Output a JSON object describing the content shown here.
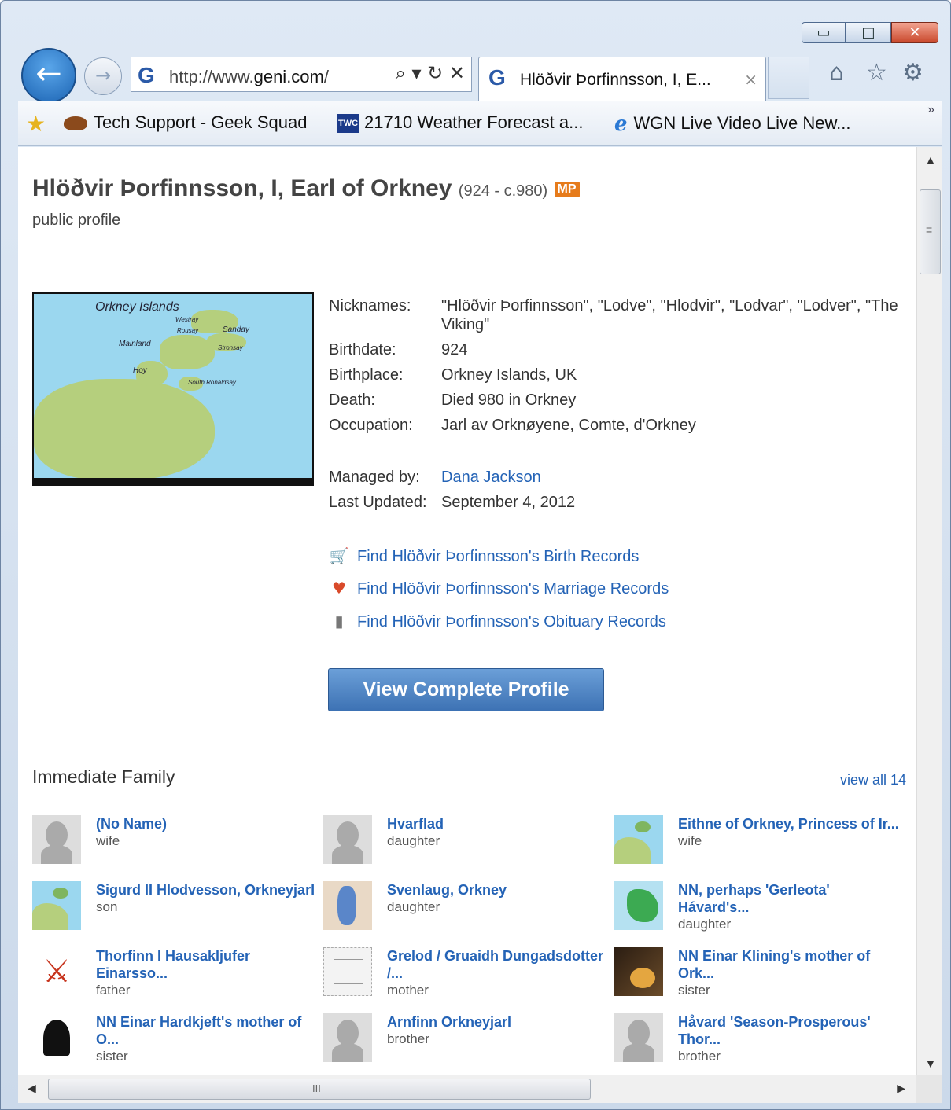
{
  "browser": {
    "window_controls": {
      "minimize": "▭",
      "maximize": "□",
      "close": "✕"
    },
    "address": {
      "prefix": "http://www.",
      "domain": "geni.com",
      "suffix": "/",
      "tools": "⌕ ▾ ↻ ✕"
    },
    "tab": {
      "title": "Hlöðvir Þorfinnsson, I, E...",
      "close": "×"
    },
    "icons": {
      "home": "⌂",
      "favorites": "☆",
      "settings": "⚙"
    },
    "favorites": [
      {
        "label": "Tech Support - Geek Squad",
        "icon": "geek-squad-icon"
      },
      {
        "label": "21710 Weather Forecast a...",
        "icon": "twc-icon",
        "badge": "TWC"
      },
      {
        "label": "WGN Live Video Live New...",
        "icon": "ie-page-icon",
        "glyph": "e"
      }
    ],
    "fav_more": "»",
    "hscroll_grip": "III"
  },
  "profile": {
    "title": "Hlöðvir Þorfinnsson, I, Earl of Orkney",
    "dates": "(924 - c.980)",
    "badge": "MP",
    "subtitle": "public profile",
    "photo_labels": [
      "Orkney Islands",
      "Westray",
      "Rousay",
      "Mainland",
      "Sanday",
      "Stronsay",
      "Hoy",
      "South Ronaldsay"
    ],
    "facts": [
      {
        "key": "Nicknames:",
        "value": "\"Hlöðvir Þorfinnsson\", \"Lodve\", \"Hlodvir\", \"Lodvar\", \"Lodver\", \"The Viking\""
      },
      {
        "key": "Birthdate:",
        "value": "924"
      },
      {
        "key": "Birthplace:",
        "value": "Orkney Islands, UK"
      },
      {
        "key": "Death:",
        "value": "Died 980 in Orkney"
      },
      {
        "key": "Occupation:",
        "value": "Jarl av Orknøyene, Comte, d'Orkney"
      }
    ],
    "managed_by_label": "Managed by:",
    "managed_by": "Dana Jackson",
    "last_updated_label": "Last Updated:",
    "last_updated": "September 4, 2012",
    "records": [
      "Find Hlöðvir Þorfinnsson's Birth Records",
      "Find Hlöðvir Þorfinnsson's Marriage Records",
      "Find Hlöðvir Þorfinnsson's Obituary Records"
    ],
    "view_button": "View Complete Profile"
  },
  "family": {
    "heading": "Immediate Family",
    "view_all": "view all 14",
    "members": [
      {
        "name": "(No Name)",
        "role": "wife",
        "thumb": "silhouette"
      },
      {
        "name": "Hvarflad",
        "role": "daughter",
        "thumb": "silhouette"
      },
      {
        "name": "Eithne of Orkney, Princess of Ir...",
        "role": "wife",
        "thumb": "map"
      },
      {
        "name": "Sigurd II Hlodvesson, Orkneyjarl",
        "role": "son",
        "thumb": "map"
      },
      {
        "name": "Svenlaug, Orkney",
        "role": "daughter",
        "thumb": "map2"
      },
      {
        "name": "NN, perhaps 'Gerleota' Hávard's...",
        "role": "daughter",
        "thumb": "map3"
      },
      {
        "name": "Thorfinn I Hausakljufer Einarsso...",
        "role": "father",
        "thumb": "sword"
      },
      {
        "name": "Grelod / Gruaidh Dungadsdotter /...",
        "role": "mother",
        "thumb": "sketch"
      },
      {
        "name": "NN Einar Klining's mother of Ork...",
        "role": "sister",
        "thumb": "food"
      },
      {
        "name": "NN Einar Hardkjeft's mother of O...",
        "role": "sister",
        "thumb": "helmet"
      },
      {
        "name": "Arnfinn Orkneyjarl",
        "role": "brother",
        "thumb": "silhouette"
      },
      {
        "name": "Håvard 'Season-Prosperous' Thor...",
        "role": "brother",
        "thumb": "silhouette"
      }
    ]
  }
}
